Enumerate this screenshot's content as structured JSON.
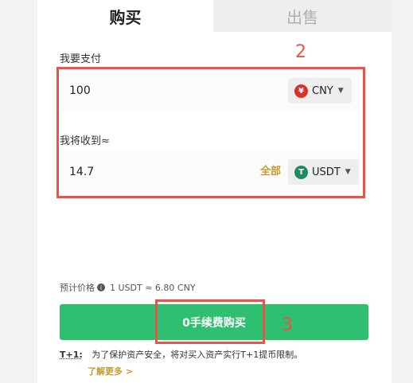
{
  "tabs": {
    "buy": "购买",
    "sell": "出售"
  },
  "pay": {
    "label": "我要支付",
    "value": "100",
    "currency": "CNY",
    "coin_color": "#d9302a"
  },
  "receive": {
    "label": "我将收到≈",
    "value": "14.7",
    "all_label": "全部",
    "currency": "USDT",
    "coin_color": "#1f8a5e"
  },
  "price": {
    "label": "预计价格",
    "value": "1 USDT ≈ 6.80 CNY"
  },
  "buy_button": {
    "label": "0手续费购买"
  },
  "notice": {
    "tag": "T+1:",
    "text": "为了保护资产安全，将对买入资产实行T+1提币限制。",
    "link": "了解更多 >"
  },
  "annotations": {
    "box2_number": "2",
    "box3_number": "3",
    "color": "#e8534a"
  },
  "colors": {
    "accent_green": "#2fbf71",
    "link_gold": "#c79a2e"
  }
}
